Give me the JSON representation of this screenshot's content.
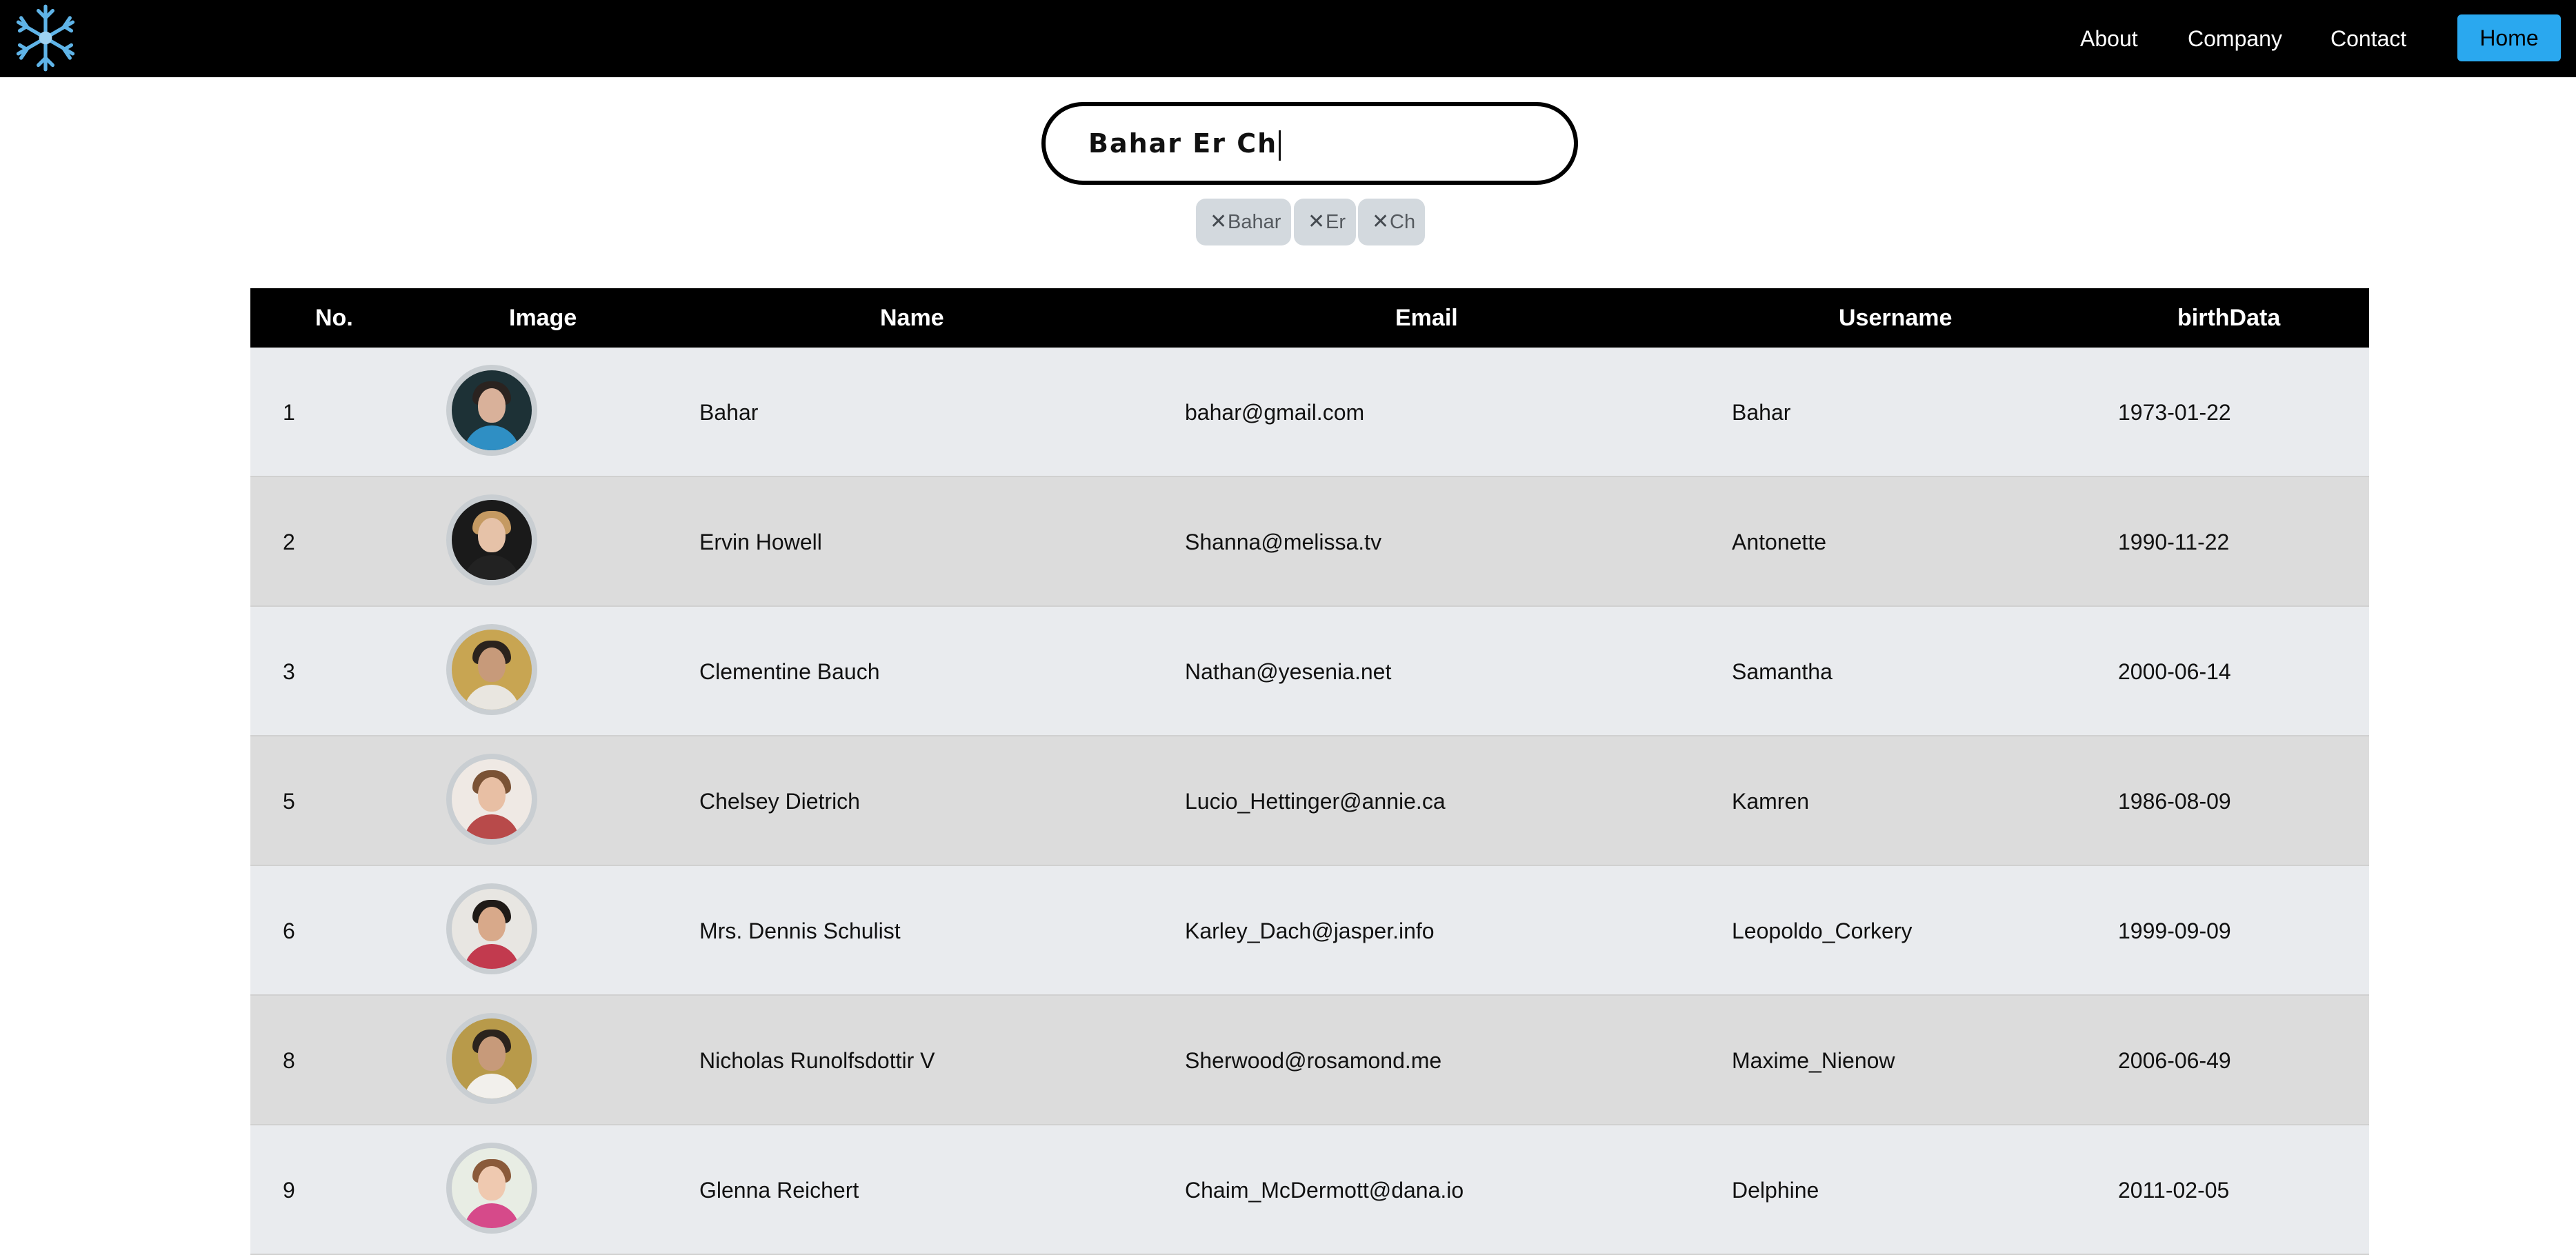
{
  "nav": {
    "links": [
      "About",
      "Company",
      "Contact"
    ],
    "home_label": "Home",
    "logo_icon": "snowflake-icon",
    "accent_color": "#2aa8ef"
  },
  "search": {
    "value": "Bahar Er Ch"
  },
  "tags": [
    {
      "label": "Bahar",
      "icon": "close-icon"
    },
    {
      "label": "Er",
      "icon": "close-icon"
    },
    {
      "label": "Ch",
      "icon": "close-icon"
    }
  ],
  "table": {
    "headers": [
      "No.",
      "Image",
      "Name",
      "Email",
      "Username",
      "birthData"
    ],
    "rows": [
      {
        "no": "1",
        "name": "Bahar",
        "email": "bahar@gmail.com",
        "username": "Bahar",
        "birth": "1973-01-22",
        "avatar": {
          "bg": "#1d3136",
          "skin": "#d9b19a",
          "hair": "#2a2320",
          "cloth": "#2f8fc4"
        }
      },
      {
        "no": "2",
        "name": "Ervin Howell",
        "email": "Shanna@melissa.tv",
        "username": "Antonette",
        "birth": "1990-11-22",
        "avatar": {
          "bg": "#1a1a1a",
          "skin": "#e6c2a8",
          "hair": "#c59a62",
          "cloth": "#222222"
        }
      },
      {
        "no": "3",
        "name": "Clementine Bauch",
        "email": "Nathan@yesenia.net",
        "username": "Samantha",
        "birth": "2000-06-14",
        "avatar": {
          "bg": "#c8a552",
          "skin": "#c79a7a",
          "hair": "#2b231d",
          "cloth": "#e9e6e0"
        }
      },
      {
        "no": "5",
        "name": "Chelsey Dietrich",
        "email": "Lucio_Hettinger@annie.ca",
        "username": "Kamren",
        "birth": "1986-08-09",
        "avatar": {
          "bg": "#efe9e4",
          "skin": "#e8bfa4",
          "hair": "#7a5235",
          "cloth": "#b84a4a"
        }
      },
      {
        "no": "6",
        "name": "Mrs. Dennis Schulist",
        "email": "Karley_Dach@jasper.info",
        "username": "Leopoldo_Corkery",
        "birth": "1999-09-09",
        "avatar": {
          "bg": "#e8e6e2",
          "skin": "#d8a98a",
          "hair": "#1f1a17",
          "cloth": "#c23a4e"
        }
      },
      {
        "no": "8",
        "name": "Nicholas Runolfsdottir V",
        "email": "Sherwood@rosamond.me",
        "username": "Maxime_Nienow",
        "birth": "2006-06-49",
        "avatar": {
          "bg": "#b89a4a",
          "skin": "#c79a7a",
          "hair": "#2b231d",
          "cloth": "#f2f0ec"
        }
      },
      {
        "no": "9",
        "name": "Glenna Reichert",
        "email": "Chaim_McDermott@dana.io",
        "username": "Delphine",
        "birth": "2011-02-05",
        "avatar": {
          "bg": "#e8ede4",
          "skin": "#efc9b0",
          "hair": "#8a5a3a",
          "cloth": "#d64a8a"
        }
      }
    ]
  }
}
